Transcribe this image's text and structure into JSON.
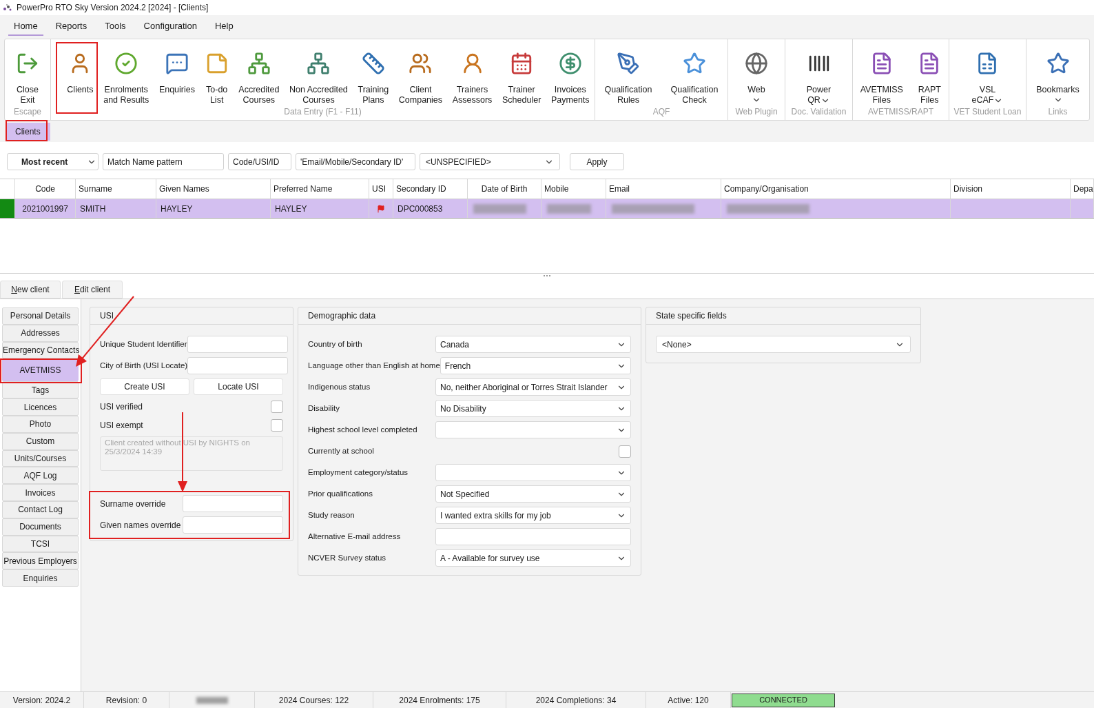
{
  "window": {
    "title": "PowerPro RTO Sky Version 2024.2 [2024] - [Clients]"
  },
  "menu": [
    {
      "label": "Home",
      "selected": true
    },
    {
      "label": "Reports",
      "selected": false
    },
    {
      "label": "Tools",
      "selected": false
    },
    {
      "label": "Configuration",
      "selected": false
    },
    {
      "label": "Help",
      "selected": false
    }
  ],
  "ribbon": {
    "groups": [
      {
        "caption": "Escape",
        "buttons": [
          {
            "lines": [
              "Close",
              "Exit"
            ]
          }
        ]
      },
      {
        "caption": "Data Entry (F1 - F11)",
        "buttons": [
          {
            "lines": [
              "Clients"
            ]
          },
          {
            "lines": [
              "Enrolments",
              "and Results"
            ]
          },
          {
            "lines": [
              "Enquiries"
            ]
          },
          {
            "lines": [
              "To-do",
              "List"
            ]
          },
          {
            "lines": [
              "Accredited",
              "Courses"
            ]
          },
          {
            "lines": [
              "Non Accredited",
              "Courses"
            ]
          },
          {
            "lines": [
              "Training",
              "Plans"
            ]
          },
          {
            "lines": [
              "Client",
              "Companies"
            ]
          },
          {
            "lines": [
              "Trainers",
              "Assessors"
            ]
          },
          {
            "lines": [
              "Trainer",
              "Scheduler"
            ]
          },
          {
            "lines": [
              "Invoices",
              "Payments"
            ]
          }
        ]
      },
      {
        "caption": "AQF",
        "buttons": [
          {
            "lines": [
              "Qualification",
              "Rules"
            ]
          },
          {
            "lines": [
              "Qualification",
              "Check"
            ]
          }
        ]
      },
      {
        "caption": "Web Plugin",
        "buttons": [
          {
            "lines": [
              "Web"
            ],
            "dropdown": true
          }
        ]
      },
      {
        "caption": "Doc. Validation",
        "buttons": [
          {
            "lines": [
              "Power",
              "QR"
            ],
            "dropdown": true
          }
        ]
      },
      {
        "caption": "AVETMISS/RAPT",
        "buttons": [
          {
            "lines": [
              "AVETMISS",
              "Files"
            ]
          },
          {
            "lines": [
              "RAPT",
              "Files"
            ]
          }
        ]
      },
      {
        "caption": "VET Student Loan",
        "buttons": [
          {
            "lines": [
              "VSL",
              "eCAF"
            ],
            "dropdown": true
          }
        ]
      },
      {
        "caption": "Links",
        "buttons": [
          {
            "lines": [
              "Bookmarks"
            ],
            "dropdown": true
          }
        ]
      }
    ]
  },
  "page_tabs": [
    {
      "label": "Clients",
      "selected": true
    }
  ],
  "filter": {
    "sort": "Most recent",
    "name_placeholder": "Match Name pattern",
    "code_placeholder": "Code/USI/ID",
    "contact_placeholder": "'Email/Mobile/Secondary ID'",
    "status": "<UNSPECIFIED>",
    "apply": "Apply"
  },
  "table": {
    "columns": [
      "Code",
      "Surname",
      "Given Names",
      "Preferred Name",
      "USI",
      "Secondary ID",
      "Date of Birth",
      "Mobile",
      "Email",
      "Company/Organisation",
      "Division",
      "Depa"
    ],
    "rows": [
      {
        "selected": true,
        "cells": [
          {
            "text": "2021001997"
          },
          {
            "text": "SMITH"
          },
          {
            "text": "HAYLEY"
          },
          {
            "text": "HAYLEY"
          },
          {
            "kind": "flag"
          },
          {
            "text": "DPC000853"
          },
          {
            "kind": "redacted"
          },
          {
            "kind": "redacted"
          },
          {
            "kind": "redacted"
          },
          {
            "kind": "redacted"
          },
          {
            "kind": "empty"
          },
          {
            "kind": "empty"
          }
        ]
      }
    ]
  },
  "actions": [
    "New client",
    "Edit client"
  ],
  "nav": [
    {
      "label": "Personal Details",
      "selected": false
    },
    {
      "label": "Addresses",
      "selected": false
    },
    {
      "label": "Emergency Contacts",
      "selected": false
    },
    {
      "label": "AVETMISS",
      "selected": true
    },
    {
      "label": "Tags",
      "selected": false
    },
    {
      "label": "Licences",
      "selected": false
    },
    {
      "label": "Photo",
      "selected": false
    },
    {
      "label": "Custom",
      "selected": false
    },
    {
      "label": "Units/Courses",
      "selected": false
    },
    {
      "label": "AQF Log",
      "selected": false
    },
    {
      "label": "Invoices",
      "selected": false
    },
    {
      "label": "Contact Log",
      "selected": false
    },
    {
      "label": "Documents",
      "selected": false
    },
    {
      "label": "TCSI",
      "selected": false
    },
    {
      "label": "Previous Employers",
      "selected": false
    },
    {
      "label": "Enquiries",
      "selected": false
    }
  ],
  "usi": {
    "title": "USI",
    "fields": [
      {
        "label": "Unique Student Identifier"
      },
      {
        "label": "City of Birth (USI Locate)"
      }
    ],
    "buttons": [
      "Create USI",
      "Locate USI"
    ],
    "checks": [
      {
        "label": "USI verified",
        "checked": false
      },
      {
        "label": "USI exempt",
        "checked": false
      }
    ],
    "note": "Client created without USI by NIGHTS on 25/3/2024 14:39",
    "overrides": [
      {
        "label": "Surname override"
      },
      {
        "label": "Given names override"
      }
    ]
  },
  "demographic": {
    "title": "Demographic data",
    "rows": [
      {
        "kind": "select",
        "label": "Country of birth",
        "value": "Canada"
      },
      {
        "kind": "select",
        "label": "Language other than English at home",
        "value": "French"
      },
      {
        "kind": "select",
        "label": "Indigenous status",
        "value": "No, neither Aboriginal or Torres Strait Islander"
      },
      {
        "kind": "select",
        "label": "Disability",
        "value": "No Disability"
      },
      {
        "kind": "select",
        "label": "Highest school level completed"
      },
      {
        "kind": "checkbox",
        "label": "Currently at school",
        "checked": false
      },
      {
        "kind": "select",
        "label": "Employment category/status"
      },
      {
        "kind": "select",
        "label": "Prior qualifications",
        "value": "Not Specified"
      },
      {
        "kind": "select",
        "label": "Study reason",
        "value": "I wanted extra skills for my job"
      },
      {
        "kind": "text",
        "label": "Alternative E-mail address"
      },
      {
        "kind": "select",
        "label": "NCVER Survey status",
        "value": "A - Available for survey use"
      }
    ]
  },
  "state_fields": {
    "title": "State specific fields",
    "value": "<None>"
  },
  "status_bar": {
    "items": [
      {
        "text": "Version: 2024.2"
      },
      {
        "text": "Revision: 0"
      },
      {
        "kind": "redacted"
      },
      {
        "text": "2024 Courses: 122"
      },
      {
        "text": "2024 Enrolments: 175"
      },
      {
        "text": "2024 Completions: 34"
      },
      {
        "text": "Active: 120"
      }
    ],
    "connection": {
      "label": "CONNECTED",
      "on": true
    }
  }
}
